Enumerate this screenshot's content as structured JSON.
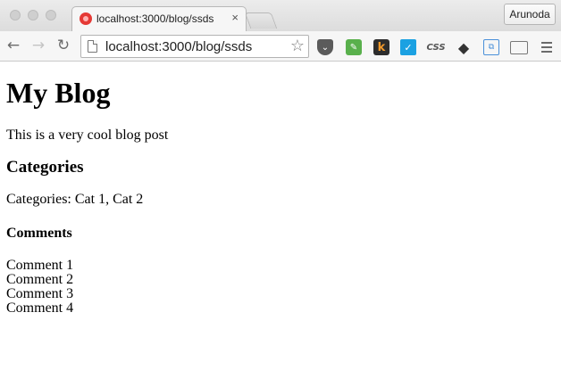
{
  "browser": {
    "tab": {
      "title": "localhost:3000/blog/ssds",
      "close": "×",
      "favicon": "meteor-icon"
    },
    "profile_name": "Arunoda",
    "toolbar": {
      "back_icon": "←",
      "forward_icon": "→",
      "reload_icon": "↻",
      "url_host": "localhost",
      "url_path": ":3000/blog/ssds",
      "star_icon": "☆"
    },
    "extensions": {
      "pocket": "⌄",
      "evernote": "✎",
      "kippt": "k",
      "check": "✓",
      "css": "CSS",
      "layers": "◆",
      "folder": "⧉",
      "cast": "",
      "menu": ""
    }
  },
  "page": {
    "title": "My Blog",
    "post": "This is a very cool blog post",
    "categories_heading": "Categories",
    "categories_text": "Categories: Cat 1, Cat 2",
    "comments_heading": "Comments",
    "comments": [
      "Comment 1",
      "Comment 2",
      "Comment 3",
      "Comment 4"
    ]
  },
  "colors": {
    "favicon": "#e53935",
    "evernote": "#59b04c",
    "check": "#1ba1e2",
    "kippt": "#f39a2b"
  }
}
